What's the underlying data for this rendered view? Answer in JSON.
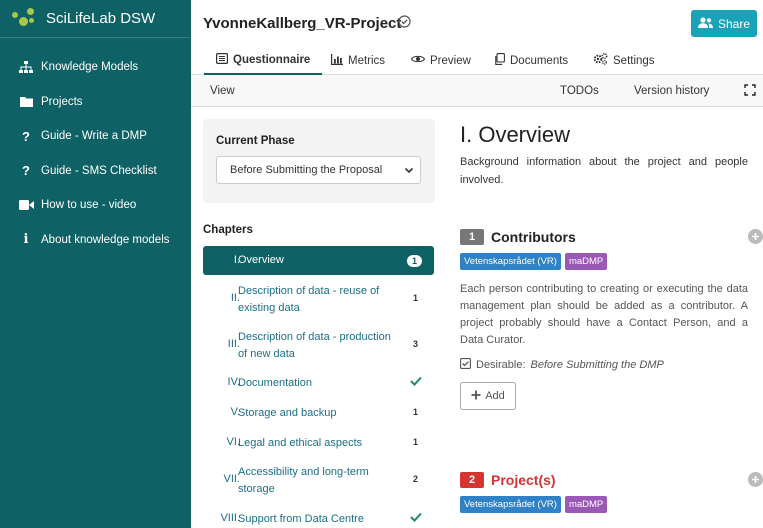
{
  "colors": {
    "sidebar_bg": "#0e6164",
    "accent": "#1aa3b8",
    "tag_vr": "#2f82c5",
    "tag_madmp": "#9b59b6",
    "q_num_gray": "#777777",
    "q_num_red": "#d63333",
    "check_green": "#1f8a61"
  },
  "brand": {
    "title": "SciLifeLab DSW"
  },
  "sidebar": {
    "items": [
      {
        "label": "Knowledge Models",
        "icon": "sitemap-icon"
      },
      {
        "label": "Projects",
        "icon": "folder-icon"
      },
      {
        "label": "Guide - Write a DMP",
        "icon": "question-icon"
      },
      {
        "label": "Guide - SMS Checklist",
        "icon": "question-icon"
      },
      {
        "label": "How to use - video",
        "icon": "video-icon"
      },
      {
        "label": "About knowledge models",
        "icon": "info-icon"
      }
    ]
  },
  "header": {
    "project_title": "YvonneKallberg_VR-Project",
    "share_label": "Share"
  },
  "tabs": [
    {
      "label": "Questionnaire",
      "icon": "list-icon"
    },
    {
      "label": "Metrics",
      "icon": "bar-chart-icon"
    },
    {
      "label": "Preview",
      "icon": "eye-icon"
    },
    {
      "label": "Documents",
      "icon": "copy-icon"
    },
    {
      "label": "Settings",
      "icon": "cogs-icon"
    }
  ],
  "subbar": {
    "view": "View",
    "todos": "TODOs",
    "version_history": "Version history"
  },
  "phase": {
    "label": "Current Phase",
    "selected": "Before Submitting the Proposal"
  },
  "chapters": {
    "label": "Chapters",
    "items": [
      {
        "num": "I.",
        "label": "Overview",
        "count": "1"
      },
      {
        "num": "II.",
        "label": "Description of data - reuse of existing data",
        "count": "1"
      },
      {
        "num": "III.",
        "label": "Description of data - production of new data",
        "count": "3"
      },
      {
        "num": "IV.",
        "label": "Documentation",
        "count": ""
      },
      {
        "num": "V.",
        "label": "Storage and backup",
        "count": "1"
      },
      {
        "num": "VI.",
        "label": "Legal and ethical aspects",
        "count": "1"
      },
      {
        "num": "VII.",
        "label": "Accessibility and long-term storage",
        "count": "2"
      },
      {
        "num": "VIII.",
        "label": "Support from Data Centre",
        "count": ""
      }
    ]
  },
  "content": {
    "title": "I. Overview",
    "intro": "Background information about the project and people involved.",
    "questions": [
      {
        "num": "1",
        "title": "Contributors",
        "tags": [
          "Vetenskapsrådet (VR)",
          "maDMP"
        ],
        "text": "Each person contributing to creating or executing the data management plan should be added as a contributor. A project probably should have a Contact Person, and a Data Curator.",
        "desirable_label": "Desirable:",
        "desirable_value": "Before Submitting the DMP",
        "add_label": "Add"
      },
      {
        "num": "2",
        "title": "Project(s)",
        "tags": [
          "Vetenskapsrådet (VR)",
          "maDMP"
        ]
      }
    ]
  }
}
